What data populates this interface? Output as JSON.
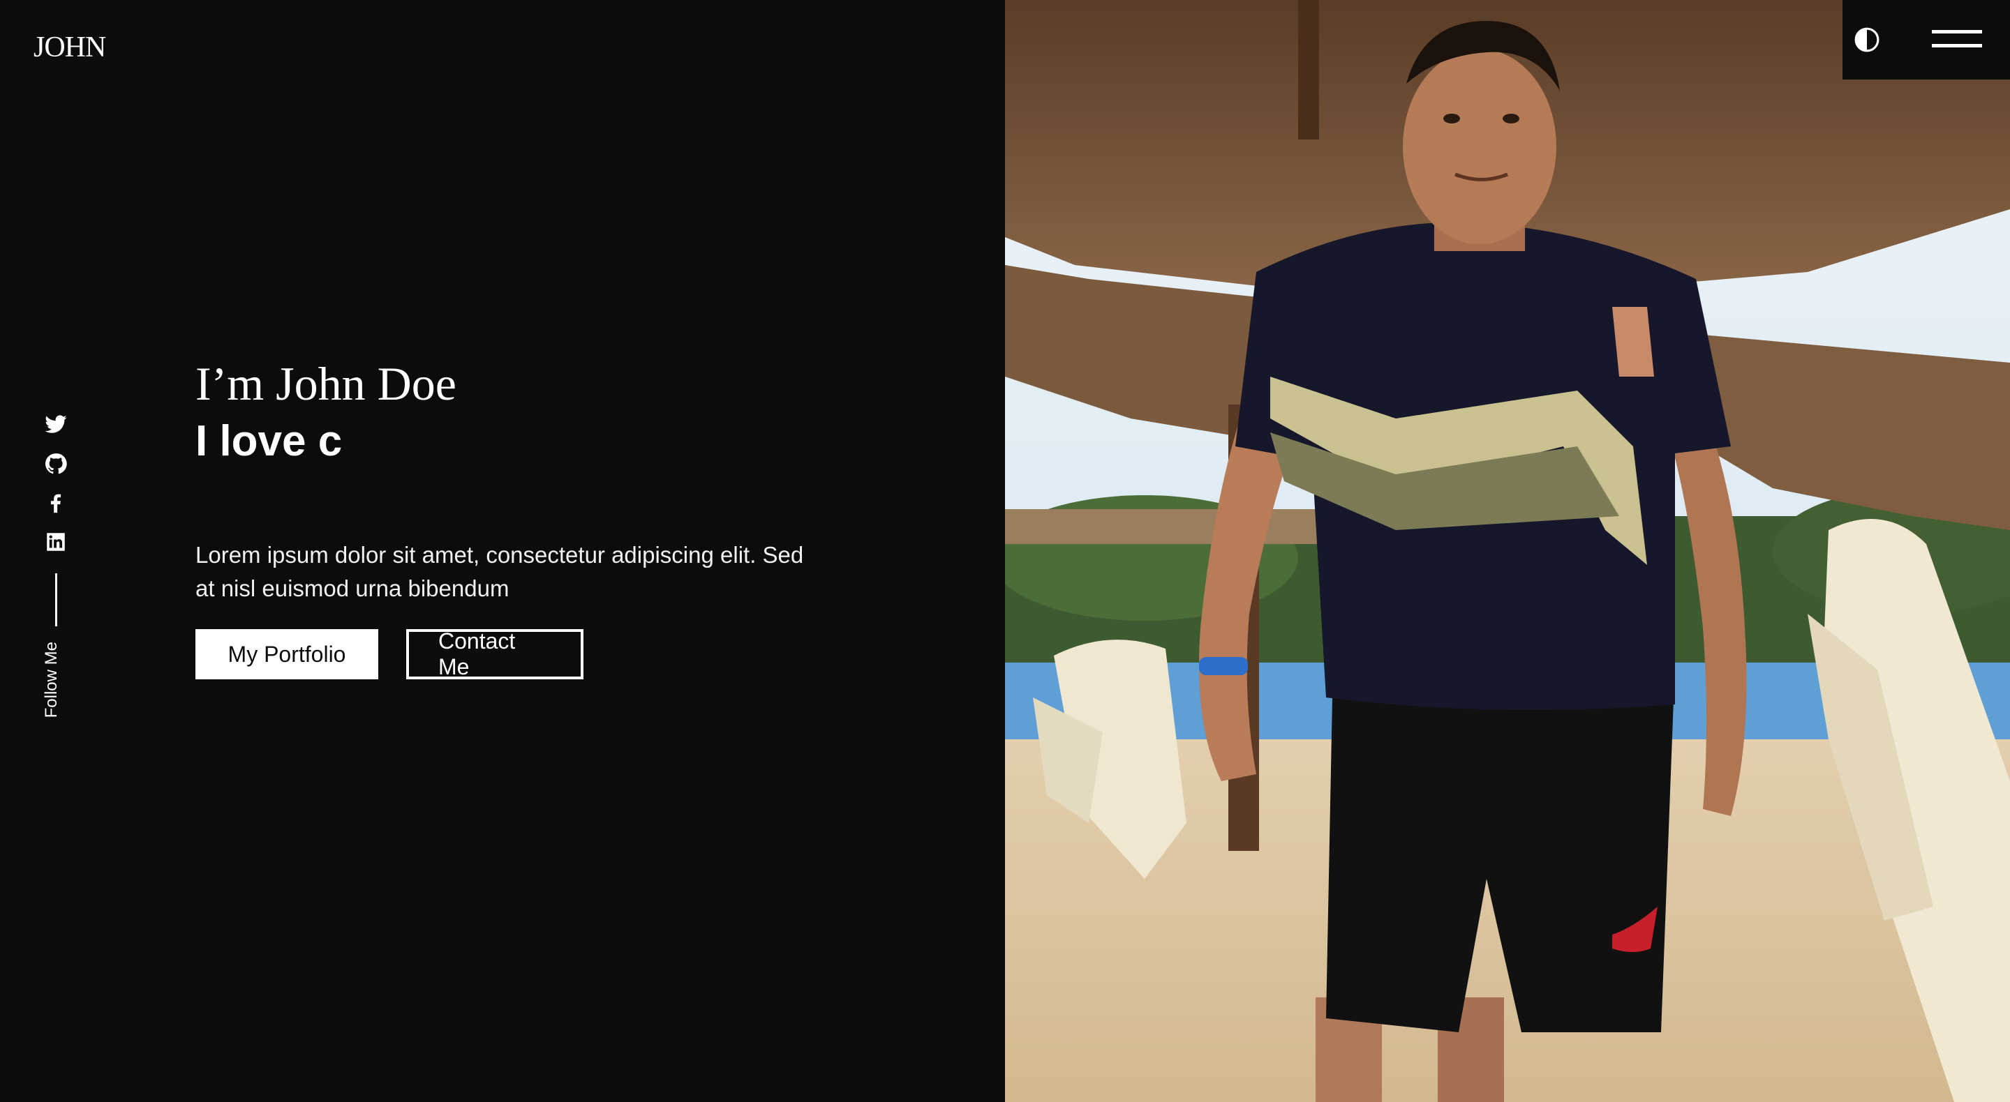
{
  "brand": {
    "logo": "JOHN"
  },
  "header": {
    "theme_toggle_icon": "contrast-icon",
    "menu_icon": "hamburger-menu-icon"
  },
  "social": {
    "items": [
      {
        "icon": "twitter-icon"
      },
      {
        "icon": "github-icon"
      },
      {
        "icon": "facebook-icon"
      },
      {
        "icon": "linkedin-icon"
      }
    ],
    "follow_label": "Follow Me"
  },
  "hero": {
    "title": "I’m John Doe",
    "typed_text": "I love c",
    "description": "Lorem ipsum dolor sit amet, consectetur adipiscing elit. Sed at nisl euismod urna bibendum",
    "primary_button": "My Portfolio",
    "secondary_button": "Contact Me"
  },
  "colors": {
    "background": "#0c0c0c",
    "text": "#ffffff",
    "button_fill": "#ffffff"
  }
}
